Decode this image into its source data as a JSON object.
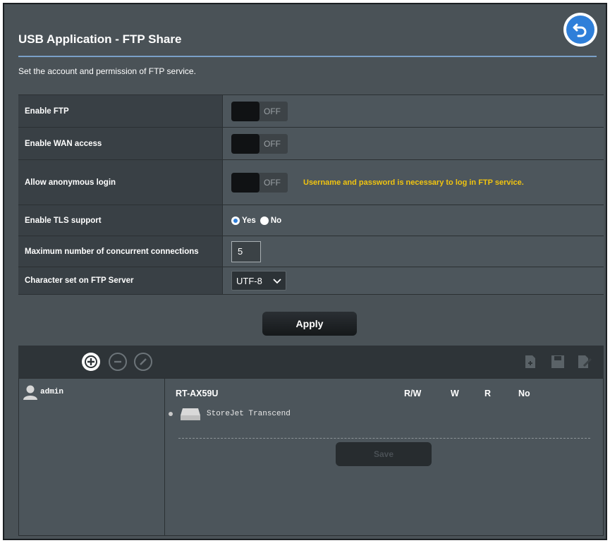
{
  "page": {
    "title": "USB Application - FTP Share",
    "subtitle": "Set the account and permission of FTP service."
  },
  "settings": {
    "enable_ftp": {
      "label": "Enable FTP",
      "state": "OFF"
    },
    "enable_wan": {
      "label": "Enable WAN access",
      "state": "OFF"
    },
    "anonymous": {
      "label": "Allow anonymous login",
      "state": "OFF",
      "note": "Username and password is necessary to log in FTP service."
    },
    "tls": {
      "label": "Enable TLS support",
      "yes": "Yes",
      "no": "No",
      "selected": "Yes"
    },
    "max_conn": {
      "label": "Maximum number of concurrent connections",
      "value": "5"
    },
    "charset": {
      "label": "Character set on FTP Server",
      "value": "UTF-8"
    }
  },
  "apply_label": "Apply",
  "accounts": {
    "user": "admin",
    "device_header": "RT-AX59U",
    "perm_cols": [
      "R/W",
      "W",
      "R",
      "No"
    ],
    "device": "StoreJet Transcend",
    "save_label": "Save"
  },
  "colors": {
    "accent": "#2f7fd9",
    "warning": "#f1c40f",
    "panel": "#4a5257"
  }
}
